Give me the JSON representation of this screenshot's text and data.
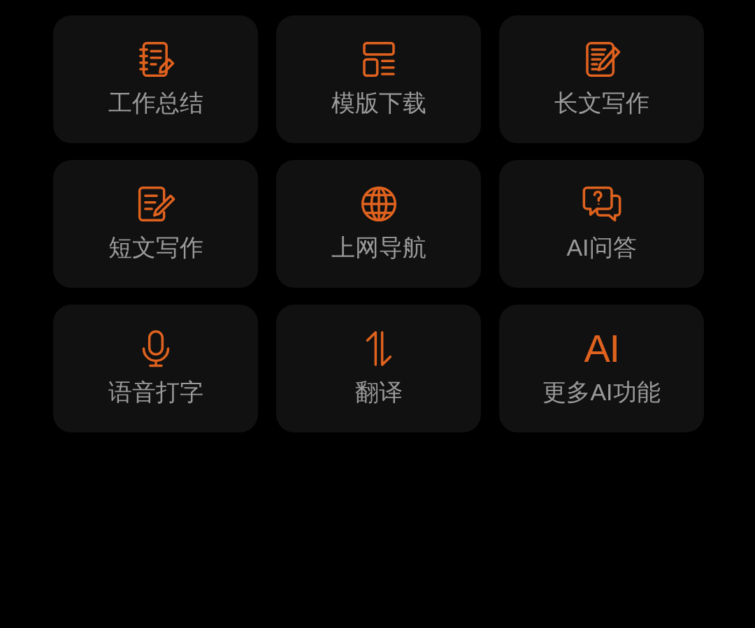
{
  "rows": [
    {
      "tiles": [
        {
          "label": "工作总结"
        },
        {
          "label": "模版下载"
        },
        {
          "label": "长文写作"
        }
      ]
    },
    {
      "tiles": [
        {
          "label": "短文写作"
        },
        {
          "label": "上网导航"
        },
        {
          "label": "AI问答"
        }
      ]
    },
    {
      "tiles": [
        {
          "label": "语音打字"
        },
        {
          "label": "翻译"
        },
        {
          "label": "更多AI功能",
          "icon_text": "AI"
        }
      ]
    }
  ]
}
